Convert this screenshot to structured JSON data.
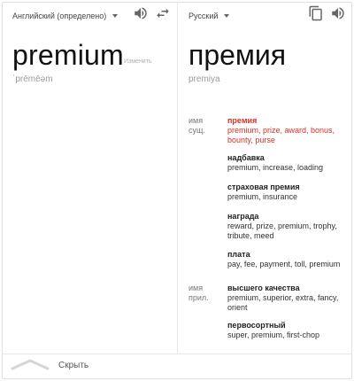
{
  "source": {
    "language": "Английский (определено)",
    "word": "premium",
    "edit": "Изменить",
    "transcription": "ˈprēmēəm"
  },
  "target": {
    "language": "Русский",
    "word": "премия",
    "transliteration": "premiya"
  },
  "dictionary": {
    "groups": [
      {
        "pos": "имя сущ.",
        "entries": [
          {
            "term": "премия",
            "synonyms": "premium, prize, award, bonus, bounty, purse"
          },
          {
            "term": "надбавка",
            "synonyms": "premium, increase, loading"
          },
          {
            "term": "страховая премия",
            "synonyms": "premium, insurance"
          },
          {
            "term": "награда",
            "synonyms": "reward, prize, premium, trophy, tribute, meed"
          },
          {
            "term": "плата",
            "synonyms": "pay, fee, payment, toll, premium"
          }
        ]
      },
      {
        "pos": "имя прил.",
        "entries": [
          {
            "term": "высшего качества",
            "synonyms": "premium, superior, extra, fancy, orient"
          },
          {
            "term": "первосортный",
            "synonyms": "super, premium, first-chop"
          }
        ]
      }
    ]
  },
  "footer": {
    "hide": "Скрыть"
  },
  "icons": [
    "speaker-icon",
    "swap-icon",
    "copy-icon",
    "chevron-up-icon"
  ],
  "colors": {
    "highlight": "#d93025",
    "muted": "#9a9a9a"
  }
}
